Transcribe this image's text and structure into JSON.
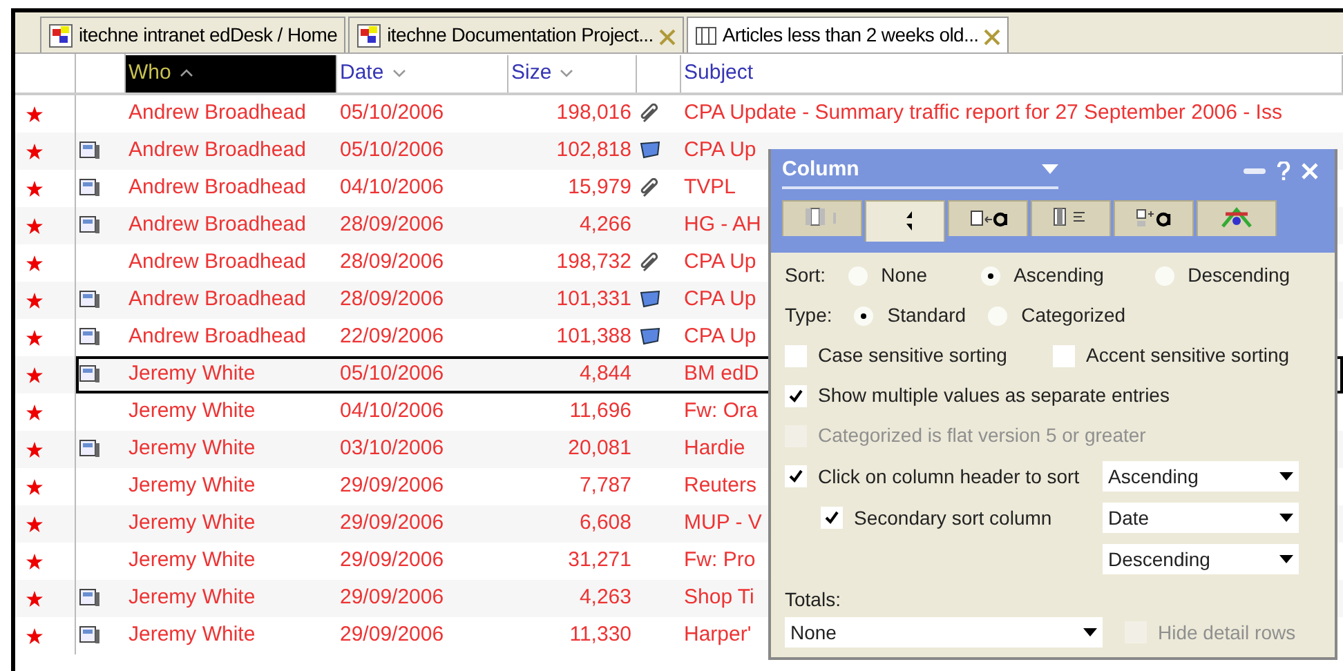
{
  "tabs": [
    {
      "label": "itechne intranet edDesk / Home",
      "selected": false,
      "close_button": false
    },
    {
      "label": "itechne Documentation Project...",
      "selected": false,
      "close_button": true
    },
    {
      "label": "Articles less than 2 weeks old...",
      "selected": true,
      "close_button": true
    }
  ],
  "columns": [
    {
      "label": "Who",
      "kind": "ascending",
      "selected": true
    },
    {
      "label": "Date",
      "kind": "descending",
      "selected": false
    },
    {
      "label": "Size",
      "kind": "descending",
      "selected": false
    },
    {
      "label": "Subject",
      "kind": "plain",
      "selected": false
    }
  ],
  "rows": [
    {
      "flagged": true,
      "document": false,
      "clip": true,
      "note": false,
      "who": "Andrew Broadhead",
      "date": "05/10/2006",
      "size": "198,016",
      "subject": "CPA Update - Summary traffic report for 27 September 2006 - Iss",
      "selected": false
    },
    {
      "flagged": true,
      "document": true,
      "clip": false,
      "note": true,
      "who": "Andrew Broadhead",
      "date": "05/10/2006",
      "size": "102,818",
      "subject": "CPA Up",
      "selected": false
    },
    {
      "flagged": true,
      "document": true,
      "clip": true,
      "note": false,
      "who": "Andrew Broadhead",
      "date": "04/10/2006",
      "size": "15,979",
      "subject": "TVPL",
      "selected": false
    },
    {
      "flagged": true,
      "document": true,
      "clip": false,
      "note": false,
      "who": "Andrew Broadhead",
      "date": "28/09/2006",
      "size": "4,266",
      "subject": "HG - AH",
      "selected": false
    },
    {
      "flagged": true,
      "document": false,
      "clip": true,
      "note": false,
      "who": "Andrew Broadhead",
      "date": "28/09/2006",
      "size": "198,732",
      "subject": "CPA Up",
      "selected": false
    },
    {
      "flagged": true,
      "document": true,
      "clip": false,
      "note": true,
      "who": "Andrew Broadhead",
      "date": "28/09/2006",
      "size": "101,331",
      "subject": "CPA Up",
      "selected": false
    },
    {
      "flagged": true,
      "document": true,
      "clip": false,
      "note": true,
      "who": "Andrew Broadhead",
      "date": "22/09/2006",
      "size": "101,388",
      "subject": "CPA Up",
      "selected": false
    },
    {
      "flagged": true,
      "document": true,
      "clip": false,
      "note": false,
      "who": "Jeremy White",
      "date": "05/10/2006",
      "size": "4,844",
      "subject": "BM edD",
      "selected": true
    },
    {
      "flagged": true,
      "document": false,
      "clip": false,
      "note": false,
      "who": "Jeremy White",
      "date": "04/10/2006",
      "size": "11,696",
      "subject": "Fw: Ora",
      "selected": false
    },
    {
      "flagged": true,
      "document": true,
      "clip": false,
      "note": false,
      "who": "Jeremy White",
      "date": "03/10/2006",
      "size": "20,081",
      "subject": "Hardie",
      "selected": false
    },
    {
      "flagged": true,
      "document": false,
      "clip": false,
      "note": false,
      "who": "Jeremy White",
      "date": "29/09/2006",
      "size": "7,787",
      "subject": "Reuters",
      "selected": false
    },
    {
      "flagged": true,
      "document": false,
      "clip": false,
      "note": false,
      "who": "Jeremy White",
      "date": "29/09/2006",
      "size": "6,608",
      "subject": "MUP - V",
      "selected": false
    },
    {
      "flagged": true,
      "document": false,
      "clip": false,
      "note": false,
      "who": "Jeremy White",
      "date": "29/09/2006",
      "size": "31,271",
      "subject": "Fw: Pro",
      "selected": false
    },
    {
      "flagged": true,
      "document": true,
      "clip": false,
      "note": false,
      "who": "Jeremy White",
      "date": "29/09/2006",
      "size": "4,263",
      "subject": "Shop Ti",
      "selected": false
    },
    {
      "flagged": true,
      "document": true,
      "clip": false,
      "note": false,
      "who": "Jeremy White",
      "date": "29/09/2006",
      "size": "11,330",
      "subject": "Harper'",
      "selected": false
    }
  ],
  "dialog": {
    "title": "Column",
    "tabs": [
      {
        "kind": "columns",
        "selected": false
      },
      {
        "kind": "sort",
        "selected": true
      },
      {
        "kind": "header-font",
        "selected": false
      },
      {
        "kind": "totals",
        "selected": false
      },
      {
        "kind": "entry-font",
        "selected": false
      },
      {
        "kind": "colors",
        "selected": false
      }
    ],
    "sort": {
      "label": "Sort:",
      "options": [
        {
          "label": "None",
          "selected": false
        },
        {
          "label": "Ascending",
          "selected": true
        },
        {
          "label": "Descending",
          "selected": false
        }
      ]
    },
    "type": {
      "label": "Type:",
      "options": [
        {
          "label": "Standard",
          "selected": true
        },
        {
          "label": "Categorized",
          "selected": false
        }
      ]
    },
    "case_sensitive": {
      "label": "Case sensitive sorting",
      "checked": false,
      "disabled": false
    },
    "accent_sensitive": {
      "label": "Accent sensitive sorting",
      "checked": false,
      "disabled": false
    },
    "multiple_values": {
      "label": "Show multiple values as separate entries",
      "checked": true,
      "disabled": false
    },
    "flat_version": {
      "label": "Categorized is flat version 5 or greater",
      "checked": false,
      "disabled": true
    },
    "header_sort": {
      "label": "Click on column header to sort",
      "checked": true,
      "disabled": false,
      "value": "Ascending"
    },
    "secondary_sort": {
      "label": "Secondary sort column",
      "checked": true,
      "disabled": false,
      "column": "Date",
      "order": "Descending"
    },
    "totals": {
      "label": "Totals:",
      "value": "None",
      "hide_detail": {
        "label": "Hide detail rows",
        "checked": false,
        "disabled": true
      }
    }
  }
}
